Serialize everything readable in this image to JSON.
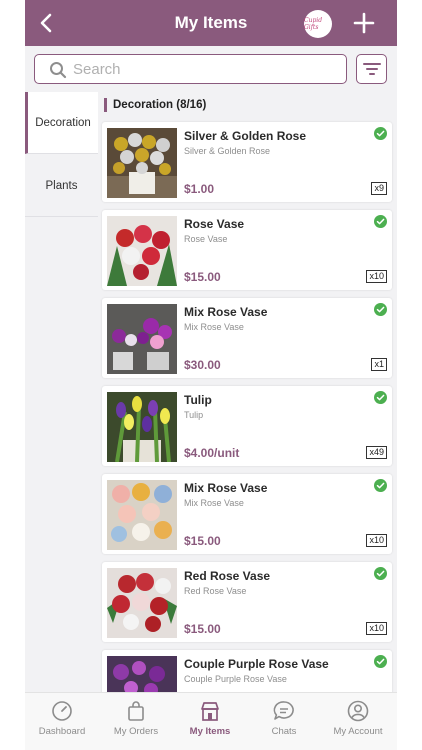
{
  "header": {
    "title": "My Items",
    "logo_text": "Cupid Gifts"
  },
  "search": {
    "placeholder": "Search",
    "value": ""
  },
  "sidebar": {
    "items": [
      {
        "label": "Decoration"
      },
      {
        "label": "Plants"
      }
    ]
  },
  "section": {
    "title": "Decoration (8/16)"
  },
  "items": [
    {
      "name": "Silver & Golden Rose",
      "subtitle": "Silver & Golden Rose",
      "price": "$1.00",
      "qty": "x9"
    },
    {
      "name": "Rose Vase",
      "subtitle": "Rose Vase",
      "price": "$15.00",
      "qty": "x10"
    },
    {
      "name": "Mix Rose Vase",
      "subtitle": "Mix Rose Vase",
      "price": "$30.00",
      "qty": "x1"
    },
    {
      "name": "Tulip",
      "subtitle": "Tulip",
      "price": "$4.00/unit",
      "qty": "x49"
    },
    {
      "name": "Mix Rose Vase",
      "subtitle": "Mix Rose Vase",
      "price": "$15.00",
      "qty": "x10"
    },
    {
      "name": "Red Rose Vase",
      "subtitle": "Red Rose Vase",
      "price": "$15.00",
      "qty": "x10"
    },
    {
      "name": "Couple Purple Rose Vase",
      "subtitle": "Couple Purple Rose Vase",
      "price": "",
      "qty": ""
    }
  ],
  "tabs": [
    {
      "label": "Dashboard",
      "icon": "speedometer-icon"
    },
    {
      "label": "My Orders",
      "icon": "shopping-bag-icon"
    },
    {
      "label": "My Items",
      "icon": "store-icon"
    },
    {
      "label": "Chats",
      "icon": "chat-bubble-icon"
    },
    {
      "label": "My Account",
      "icon": "user-circle-icon"
    }
  ],
  "colors": {
    "brand": "#8a5a7d",
    "status": "#4caf50",
    "background": "#f2f2f4"
  }
}
